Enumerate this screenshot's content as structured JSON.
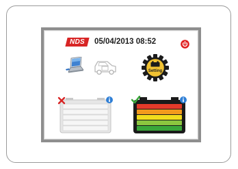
{
  "header": {
    "brand": "NDS",
    "datetime": "05/04/2013 08:52"
  },
  "icons": {
    "power": "power-icon",
    "laptop": "laptop-icon",
    "car": "car-icon",
    "setting": "setting-gear-icon"
  },
  "setting": {
    "label": "Setting"
  },
  "battery_tiles": [
    {
      "status": "error",
      "status_icon": "red-x-icon",
      "info_icon": "info-icon",
      "level_bars": 5,
      "charge_colors": []
    },
    {
      "status": "ok",
      "status_icon": "green-check-icon",
      "info_icon": "info-icon",
      "level_bars": 5,
      "charge_colors": [
        "#e43a2a",
        "#f39a1d",
        "#f2dc1d",
        "#8cc63f",
        "#3aa63a"
      ]
    }
  ],
  "colors": {
    "brand_red": "#d82525",
    "power_red": "#e02020",
    "bezel_gray": "#8e8e8e",
    "battery_body": "#1a1a1a",
    "info_blue": "#2f7fd6"
  }
}
